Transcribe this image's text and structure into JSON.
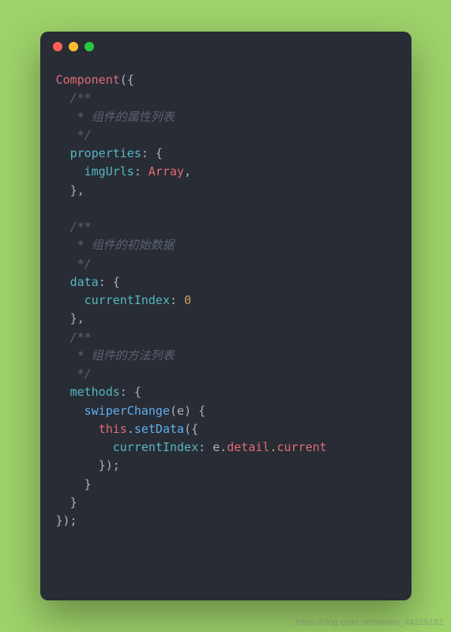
{
  "code": {
    "fn": "Component",
    "open_paren": "(",
    "open_brace": "{",
    "c1_open": "/**",
    "c1_body": " * 组件的属性列表",
    "c1_close": " */",
    "k_properties": "properties",
    "colon": ":",
    "space_brace": " {",
    "k_imgUrls": "imgUrls",
    "t_Array": "Array",
    "comma": ",",
    "close_brace": "}",
    "close_brace_comma": "},",
    "c2_open": "/**",
    "c2_body": " * 组件的初始数据",
    "c2_close": " */",
    "k_data": "data",
    "k_currentIndex": "currentIndex",
    "v_zero": "0",
    "c3_open": "/**",
    "c3_body": " * 组件的方法列表",
    "c3_close": " */",
    "k_methods": "methods",
    "m_swiperChange": "swiperChange",
    "p_e": "e",
    "close_paren": ")",
    "t_this": "this",
    "dot": ".",
    "m_setData": "setData",
    "p_detail": "detail",
    "p_current": "current",
    "close_all": "});",
    "semicolon_brace": "});"
  },
  "watermark": "https://blog.csdn.net/weixin_44225182"
}
